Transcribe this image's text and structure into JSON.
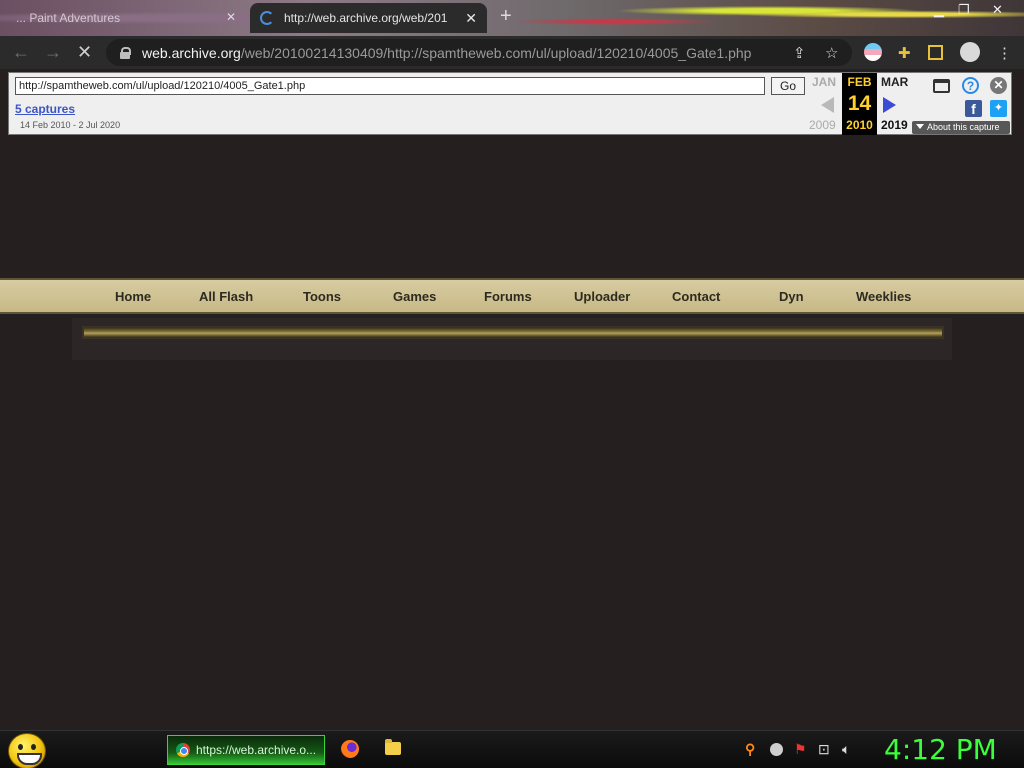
{
  "browser": {
    "tabs": [
      {
        "title": "... Paint Adventures",
        "active": false
      },
      {
        "title": "http://web.archive.org/web/201",
        "active": true
      }
    ],
    "address": {
      "host": "web.archive.org",
      "path": "/web/20100214130409/http://spamtheweb.com/ul/upload/120210/4005_Gate1.php"
    }
  },
  "wayback": {
    "url_value": "http://spamtheweb.com/ul/upload/120210/4005_Gate1.php",
    "go_label": "Go",
    "captures": "5 captures",
    "capture_range": "14 Feb 2010 - 2 Jul 2020",
    "prev": {
      "month": "JAN",
      "year": "2009"
    },
    "current": {
      "month": "FEB",
      "day": "14",
      "year": "2010"
    },
    "next": {
      "month": "MAR",
      "year": "2019"
    },
    "about_label": "About this capture",
    "colors": {
      "current_bg": "#000000",
      "current_text": "#ffd12c",
      "next_arrow": "#3b4bd6"
    }
  },
  "site_nav": {
    "items": [
      "Home",
      "All Flash",
      "Toons",
      "Games",
      "Forums",
      "Uploader",
      "Contact",
      "Dyn",
      "Weeklies"
    ],
    "colors": {
      "strip": "#d7cca1",
      "text": "#2d2a20",
      "page_bg": "#251f1f"
    }
  },
  "taskbar": {
    "task_label": "https://web.archive.o...",
    "clock": "4:12 PM",
    "colors": {
      "clock": "#3cff3c",
      "task_border": "#3bd23b"
    }
  }
}
